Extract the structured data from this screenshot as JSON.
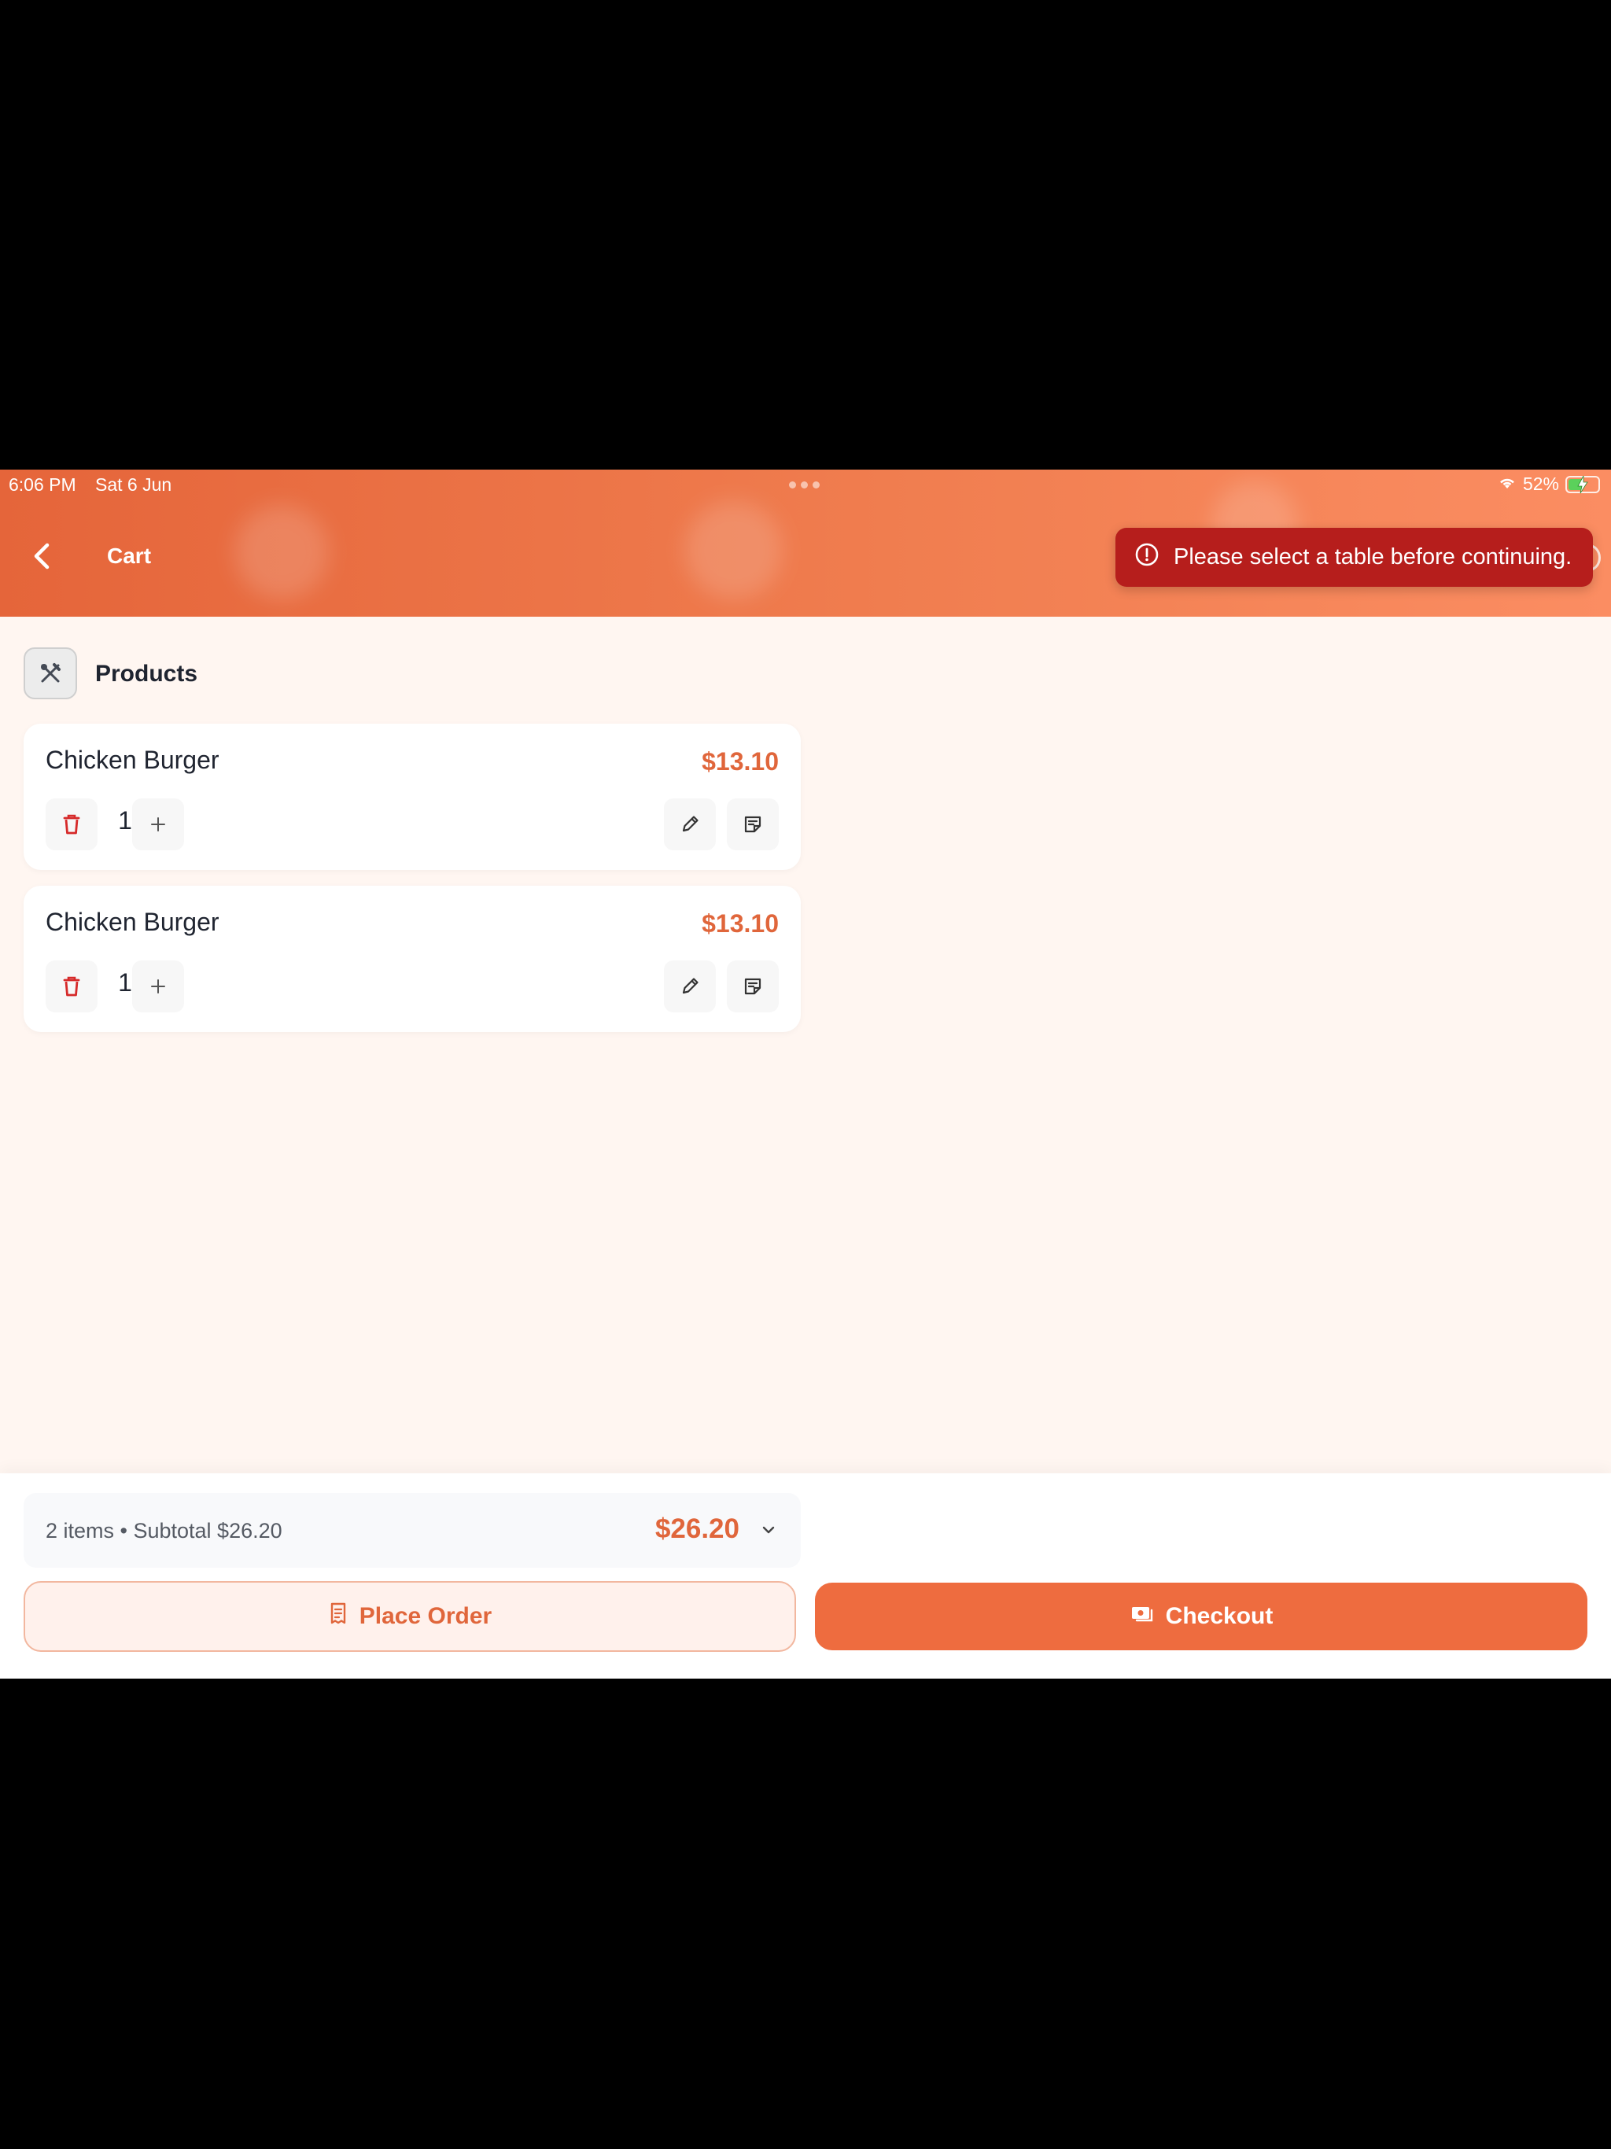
{
  "status_bar": {
    "time": "6:06 PM",
    "date": "Sat 6 Jun",
    "battery": "52%"
  },
  "header": {
    "title": "Cart"
  },
  "toast": {
    "message": "Please select a table before continuing."
  },
  "section": {
    "title": "Products"
  },
  "cart_items": [
    {
      "name": "Chicken Burger",
      "price": "$13.10",
      "quantity": "1"
    },
    {
      "name": "Chicken Burger",
      "price": "$13.10",
      "quantity": "1"
    }
  ],
  "summary": {
    "text": "2 items • Subtotal $26.20",
    "total": "$26.20"
  },
  "actions": {
    "place_order": "Place Order",
    "checkout": "Checkout"
  },
  "colors": {
    "accent": "#ee6c3f",
    "price": "#e0663b",
    "toast": "#b61e1c",
    "delete": "#d62a2a"
  },
  "icons": [
    "back-chevron-icon",
    "alert-circle-icon",
    "utensils-icon",
    "trash-icon",
    "plus-icon",
    "pencil-icon",
    "note-icon",
    "chevron-down-icon",
    "receipt-icon",
    "cash-icon",
    "wifi-icon",
    "battery-icon"
  ]
}
